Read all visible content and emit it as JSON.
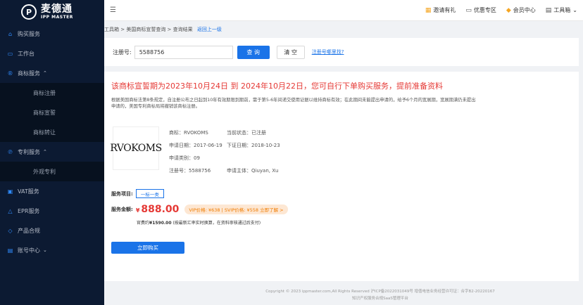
{
  "sidebar": {
    "logo_cn": "麦德通",
    "logo_en": "IPP MASTER",
    "items": [
      {
        "label": "购买服务",
        "icon": "cart-icon"
      },
      {
        "label": "工作台",
        "icon": "desktop-icon"
      },
      {
        "label": "商标服务",
        "icon": "trademark-icon",
        "expanded": true
      },
      {
        "label": "商标注册",
        "sub": true
      },
      {
        "label": "商标宣誓",
        "sub": true
      },
      {
        "label": "商标转让",
        "sub": true
      },
      {
        "label": "专利服务",
        "icon": "patent-icon",
        "expanded": true
      },
      {
        "label": "外观专利",
        "sub": true
      },
      {
        "label": "VAT服务",
        "icon": "vat-icon"
      },
      {
        "label": "EPR服务",
        "icon": "epr-icon"
      },
      {
        "label": "产品合规",
        "icon": "shield-icon"
      },
      {
        "label": "账号中心",
        "icon": "account-icon"
      }
    ]
  },
  "header": {
    "links": [
      {
        "label": "邀请有礼",
        "icon": "gift-icon"
      },
      {
        "label": "优惠专区",
        "icon": "coupon-icon"
      },
      {
        "label": "会员中心",
        "icon": "diamond-icon"
      },
      {
        "label": "工具箱",
        "icon": "toolbox-icon"
      }
    ]
  },
  "breadcrumb": {
    "path": "工具箱 > 美国商标宣誓查询 > 查询结果",
    "back": "返回上一级"
  },
  "search": {
    "label": "注册号:",
    "value": "5588756",
    "query_btn": "查 询",
    "clear_btn": "清 空",
    "help_link": "注册号哪里找?"
  },
  "result": {
    "title": "该商标宣誓期为2023年10月24日 到 2024年10月22日，您可自行下单购买服务，提前准备资料",
    "desc": "根据美国商标法第8条规定，自注册公布之日起到10年有效期限到期前，需于第5-6年间递交使用证据以维持商标有效；在此期间未能提出申请的，给予6个月的宽展期，宽展期满仍未提出申请的，美国专利商标局将撤销该商标注册。",
    "trademark_logo_text": "RVOKOMS",
    "info": {
      "name": "商标：RVOKOMS",
      "status": "当前状态：已注册",
      "apply_date": "申请日期：2017-06-19",
      "reg_date": "下证日期：2018-10-23",
      "class": "申请类别：09",
      "reg_no": "注册号：5588756",
      "owner": "申请主体：Qiuyan, Xu"
    },
    "service_label": "服务项目:",
    "service_option": "一标一类",
    "price_label": "服务金额:",
    "price_currency": "¥",
    "price_value": "888.00",
    "vip_text": "VIP价格: ¥638 | SVIP价格: ¥558 立即了解 >",
    "orig_price_prefix": "官费约",
    "orig_price_value": "¥1590.00",
    "orig_price_note": "(按最新汇率实时换算，在资料审核通过后支付)",
    "buy_btn": "立即购买"
  },
  "footer": {
    "line1": "Copyright © 2023 ippmaster.com,All Rights Reserved 沪ICP备2022031049号  增值电信业务经营许可证：合字B2-20220167",
    "line2": "知识产权服务合规SaaS管理平台"
  }
}
